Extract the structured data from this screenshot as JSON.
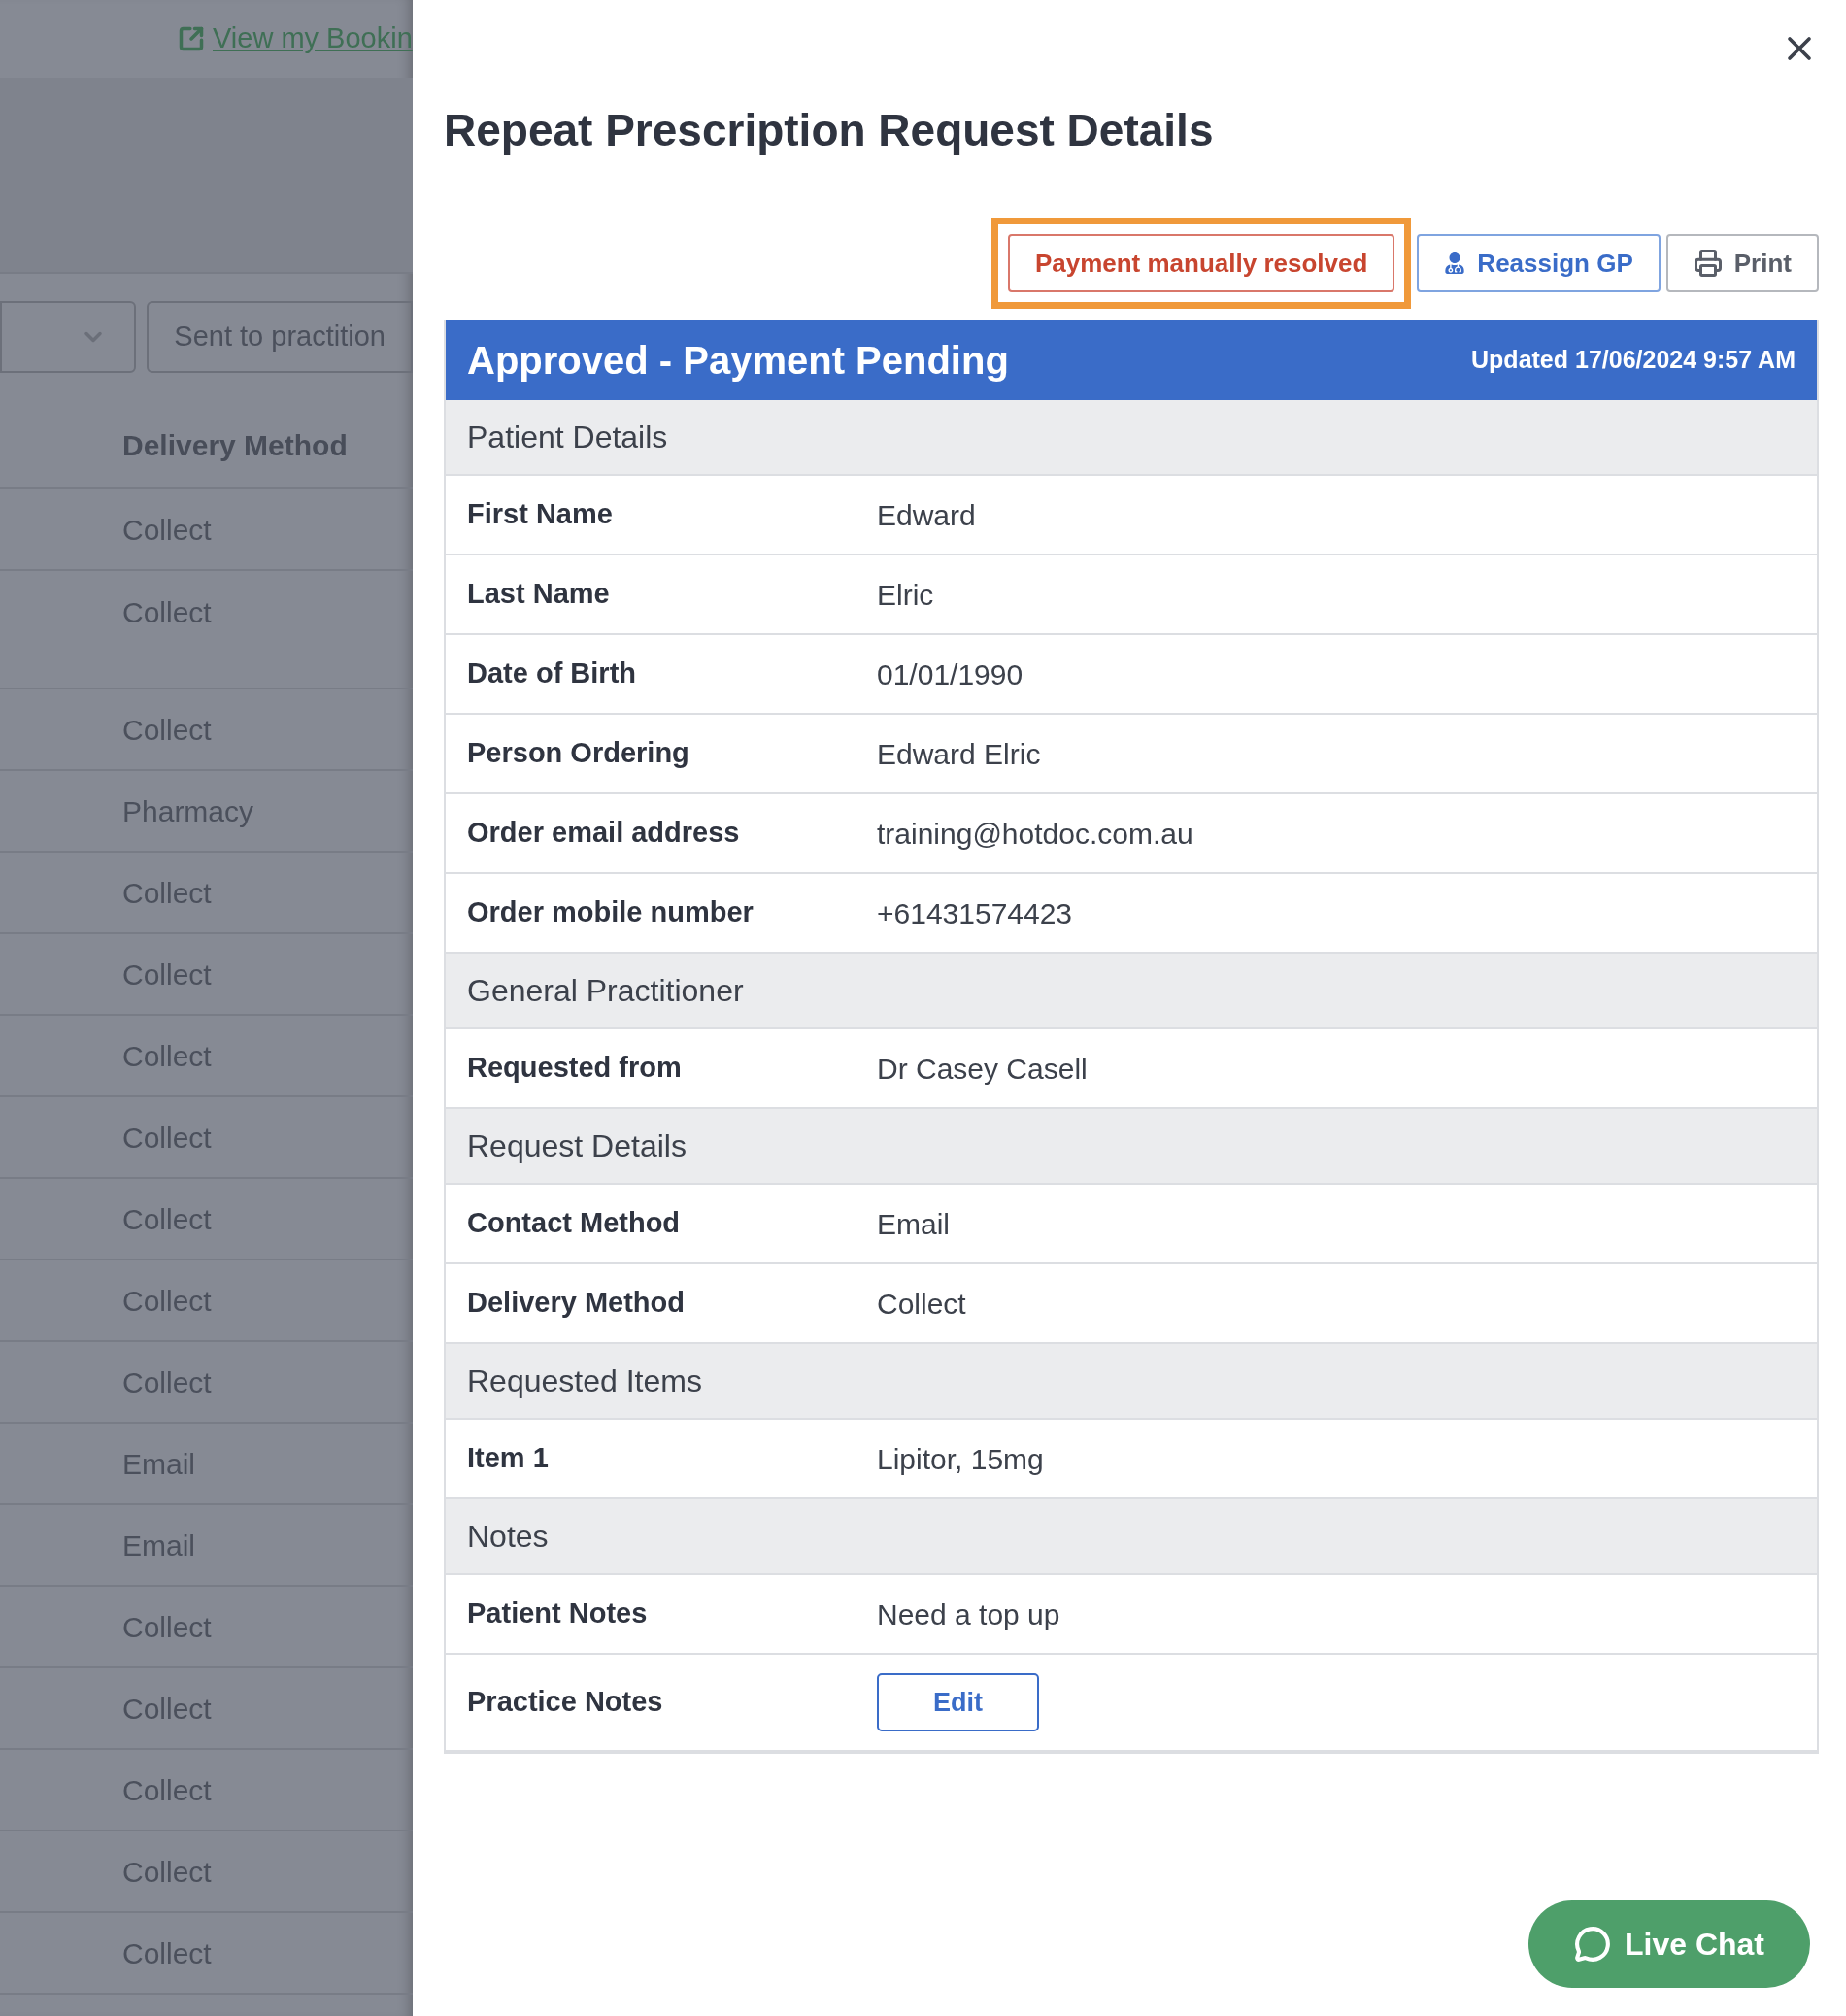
{
  "background": {
    "link": "View my Bookin",
    "status_filter": {
      "value": "Sent to practition"
    },
    "column_header": "Delivery Method",
    "rows": [
      {
        "value": "Collect",
        "tall": false
      },
      {
        "value": "Collect",
        "tall": true
      },
      {
        "value": "Collect",
        "tall": false
      },
      {
        "value": "Pharmacy",
        "tall": false
      },
      {
        "value": "Collect",
        "tall": false
      },
      {
        "value": "Collect",
        "tall": false
      },
      {
        "value": "Collect",
        "tall": false
      },
      {
        "value": "Collect",
        "tall": false
      },
      {
        "value": "Collect",
        "tall": false
      },
      {
        "value": "Collect",
        "tall": false
      },
      {
        "value": "Collect",
        "tall": false
      },
      {
        "value": "Email",
        "tall": false
      },
      {
        "value": "Email",
        "tall": false
      },
      {
        "value": "Collect",
        "tall": false
      },
      {
        "value": "Collect",
        "tall": false
      },
      {
        "value": "Collect",
        "tall": false
      },
      {
        "value": "Collect",
        "tall": false
      },
      {
        "value": "Collect",
        "tall": false
      }
    ]
  },
  "modal": {
    "title": "Repeat Prescription Request Details",
    "buttons": [
      {
        "label": "Payment manually resolved",
        "kind": "resolve",
        "highlighted": true
      },
      {
        "label": "Reassign GP",
        "kind": "reassign",
        "highlighted": false
      },
      {
        "label": "Print",
        "kind": "print",
        "highlighted": false
      }
    ],
    "status": {
      "label": "Approved - Payment Pending",
      "updated": "Updated 17/06/2024 9:57 AM"
    },
    "sections": [
      {
        "title": "Patient Details",
        "rows": [
          {
            "label": "First Name",
            "value": "Edward",
            "kind": "text"
          },
          {
            "label": "Last Name",
            "value": "Elric",
            "kind": "text"
          },
          {
            "label": "Date of Birth",
            "value": "01/01/1990",
            "kind": "text"
          },
          {
            "label": "Person Ordering",
            "value": "Edward Elric",
            "kind": "text"
          },
          {
            "label": "Order email address",
            "value": "training@hotdoc.com.au",
            "kind": "text"
          },
          {
            "label": "Order mobile number",
            "value": "+61431574423",
            "kind": "text"
          }
        ]
      },
      {
        "title": "General Practitioner",
        "rows": [
          {
            "label": "Requested from",
            "value": "Dr Casey Casell",
            "kind": "text"
          }
        ]
      },
      {
        "title": "Request Details",
        "rows": [
          {
            "label": "Contact Method",
            "value": "Email",
            "kind": "text"
          },
          {
            "label": "Delivery Method",
            "value": "Collect",
            "kind": "text"
          }
        ]
      },
      {
        "title": "Requested Items",
        "rows": [
          {
            "label": "Item 1",
            "value": "Lipitor, 15mg",
            "kind": "text"
          }
        ]
      },
      {
        "title": "Notes",
        "rows": [
          {
            "label": "Patient Notes",
            "value": "Need a top up",
            "kind": "text"
          },
          {
            "label": "Practice Notes",
            "value": "Edit",
            "kind": "button"
          }
        ]
      }
    ]
  },
  "live_chat": {
    "label": "Live Chat"
  }
}
